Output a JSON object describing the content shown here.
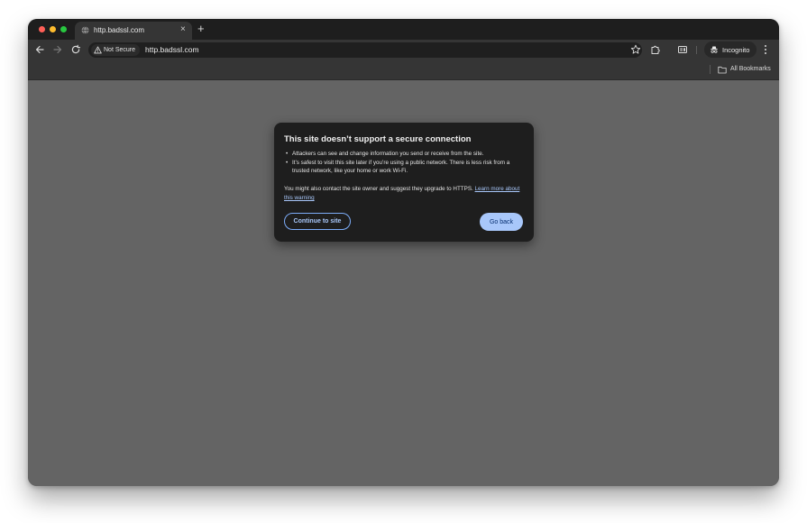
{
  "tab": {
    "title": "http.badssl.com",
    "close": "×",
    "new_tab": "+"
  },
  "omnibox": {
    "security_chip": "Not Secure",
    "url": "http.badssl.com"
  },
  "profile": {
    "label": "Incognito"
  },
  "bookmarks": {
    "all_bookmarks": "All Bookmarks"
  },
  "bubble": {
    "title": "This site doesn’t support a secure connection",
    "bullets": [
      "Attackers can see and change information you send or receive from the site.",
      "It’s safest to visit this site later if you’re using a public network. There is less risk from a trusted network, like your home or work Wi-Fi."
    ],
    "note_text": "You might also contact the site owner and suggest they upgrade to HTTPS. ",
    "note_link": "Learn more about this warning",
    "continue_label": "Continue to site",
    "back_label": "Go back"
  },
  "icons": {
    "tab_favicon": "globe-icon",
    "back": "arrow-left-icon",
    "forward": "arrow-right-icon",
    "reload": "reload-icon",
    "security": "warning-triangle-icon",
    "bookmark": "star-icon",
    "extensions": "puzzle-icon",
    "reading_mode": "reading-mode-icon",
    "incognito": "incognito-icon",
    "menu": "kebab-menu-icon",
    "bookmarks_folder": "folder-icon"
  },
  "colors": {
    "tabstrip": "#1e1e1e",
    "toolbar": "#353535",
    "content": "#646464",
    "bubble": "#1e1e1e",
    "accent": "#a8c7fa",
    "traffic_red": "#ff5f57",
    "traffic_yellow": "#febc2e",
    "traffic_green": "#28c840"
  }
}
